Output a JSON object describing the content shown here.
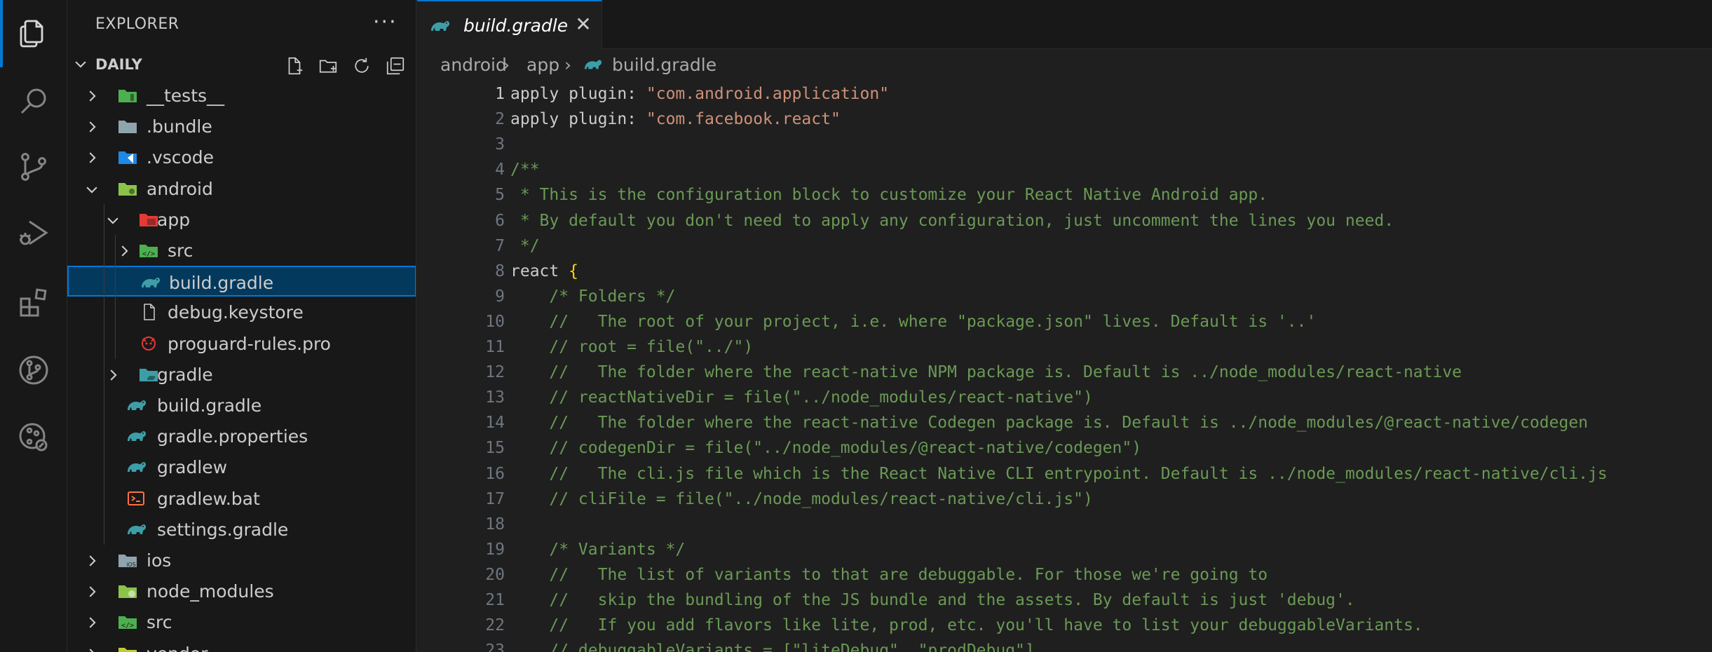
{
  "activity_bar": {
    "items": [
      {
        "name": "explorer-icon",
        "active": true
      },
      {
        "name": "search-icon"
      },
      {
        "name": "source-control-icon"
      },
      {
        "name": "run-debug-icon"
      },
      {
        "name": "extensions-icon"
      },
      {
        "name": "git-graph-icon"
      },
      {
        "name": "remote-explorer-icon"
      }
    ]
  },
  "sidebar": {
    "title": "EXPLORER",
    "more_label": "···",
    "section_label": "DAILY",
    "tree": [
      {
        "label": "__tests__",
        "depth": 0,
        "chevron": "right",
        "icon": "folder-tests",
        "color": "#4caf50"
      },
      {
        "label": ".bundle",
        "depth": 0,
        "chevron": "right",
        "icon": "folder",
        "color": "#90a4ae"
      },
      {
        "label": ".vscode",
        "depth": 0,
        "chevron": "right",
        "icon": "folder-vscode",
        "color": "#1e88e5"
      },
      {
        "label": "android",
        "depth": 0,
        "chevron": "down",
        "icon": "folder-android",
        "color": "#8bc34a"
      },
      {
        "label": "app",
        "depth": 1,
        "chevron": "down",
        "icon": "folder-app",
        "color": "#e53935"
      },
      {
        "label": "src",
        "depth": 2,
        "chevron": "right",
        "icon": "folder-src",
        "color": "#4caf50"
      },
      {
        "label": "build.gradle",
        "depth": 2,
        "chevron": "none",
        "icon": "gradle",
        "color": "#3d9ea8",
        "selected": true
      },
      {
        "label": "debug.keystore",
        "depth": 2,
        "chevron": "none",
        "icon": "file",
        "color": "#cccccc"
      },
      {
        "label": "proguard-rules.pro",
        "depth": 2,
        "chevron": "none",
        "icon": "proguard",
        "color": "#e53935"
      },
      {
        "label": "gradle",
        "depth": 1,
        "chevron": "right",
        "icon": "folder-gradle",
        "color": "#3d9ea8"
      },
      {
        "label": "build.gradle",
        "depth": 1,
        "chevron": "none",
        "icon": "gradle",
        "color": "#3d9ea8"
      },
      {
        "label": "gradle.properties",
        "depth": 1,
        "chevron": "none",
        "icon": "gradle",
        "color": "#3d9ea8"
      },
      {
        "label": "gradlew",
        "depth": 1,
        "chevron": "none",
        "icon": "gradle",
        "color": "#3d9ea8"
      },
      {
        "label": "gradlew.bat",
        "depth": 1,
        "chevron": "none",
        "icon": "terminal",
        "color": "#ff7043"
      },
      {
        "label": "settings.gradle",
        "depth": 1,
        "chevron": "none",
        "icon": "gradle",
        "color": "#3d9ea8"
      },
      {
        "label": "ios",
        "depth": 0,
        "chevron": "right",
        "icon": "folder-ios",
        "color": "#90a4ae"
      },
      {
        "label": "node_modules",
        "depth": 0,
        "chevron": "right",
        "icon": "folder-node",
        "color": "#8bc34a"
      },
      {
        "label": "src",
        "depth": 0,
        "chevron": "right",
        "icon": "folder-src",
        "color": "#4caf50"
      },
      {
        "label": "vendor",
        "depth": 0,
        "chevron": "right",
        "icon": "folder-vendor",
        "color": "#c0ca33"
      }
    ]
  },
  "editor": {
    "tab": {
      "label": "build.gradle",
      "close": "✕"
    },
    "breadcrumb": [
      "android",
      "app",
      "build.gradle"
    ],
    "active_line": 1,
    "lines": [
      {
        "n": "1",
        "tokens": [
          {
            "t": "apply plugin: ",
            "k": "plain"
          },
          {
            "t": "\"com.android.application\"",
            "k": "str"
          }
        ]
      },
      {
        "n": "2",
        "tokens": [
          {
            "t": "apply plugin: ",
            "k": "plain"
          },
          {
            "t": "\"com.facebook.react\"",
            "k": "str"
          }
        ]
      },
      {
        "n": "3",
        "tokens": []
      },
      {
        "n": "4",
        "tokens": [
          {
            "t": "/**",
            "k": "cm"
          }
        ]
      },
      {
        "n": "5",
        "tokens": [
          {
            "t": " * This is the configuration block to customize your React Native Android app.",
            "k": "cm"
          }
        ]
      },
      {
        "n": "6",
        "tokens": [
          {
            "t": " * By default you don't need to apply any configuration, just uncomment the lines you need.",
            "k": "cm"
          }
        ]
      },
      {
        "n": "7",
        "tokens": [
          {
            "t": " */",
            "k": "cm"
          }
        ]
      },
      {
        "n": "8",
        "tokens": [
          {
            "t": "react ",
            "k": "plain"
          },
          {
            "t": "{",
            "k": "br"
          }
        ]
      },
      {
        "n": "9",
        "tokens": [
          {
            "t": "    /* Folders */",
            "k": "cm"
          }
        ]
      },
      {
        "n": "10",
        "tokens": [
          {
            "t": "    //   The root of your project, i.e. where \"package.json\" lives. Default is '..'",
            "k": "cm"
          }
        ]
      },
      {
        "n": "11",
        "tokens": [
          {
            "t": "    // root = file(\"../\")",
            "k": "cm"
          }
        ]
      },
      {
        "n": "12",
        "tokens": [
          {
            "t": "    //   The folder where the react-native NPM package is. Default is ../node_modules/react-native",
            "k": "cm"
          }
        ]
      },
      {
        "n": "13",
        "tokens": [
          {
            "t": "    // reactNativeDir = file(\"../node_modules/react-native\")",
            "k": "cm"
          }
        ]
      },
      {
        "n": "14",
        "tokens": [
          {
            "t": "    //   The folder where the react-native Codegen package is. Default is ../node_modules/@react-native/codegen",
            "k": "cm"
          }
        ]
      },
      {
        "n": "15",
        "tokens": [
          {
            "t": "    // codegenDir = file(\"../node_modules/@react-native/codegen\")",
            "k": "cm"
          }
        ]
      },
      {
        "n": "16",
        "tokens": [
          {
            "t": "    //   The cli.js file which is the React Native CLI entrypoint. Default is ../node_modules/react-native/cli.js",
            "k": "cm"
          }
        ]
      },
      {
        "n": "17",
        "tokens": [
          {
            "t": "    // cliFile = file(\"../node_modules/react-native/cli.js\")",
            "k": "cm"
          }
        ]
      },
      {
        "n": "18",
        "tokens": []
      },
      {
        "n": "19",
        "tokens": [
          {
            "t": "    /* Variants */",
            "k": "cm"
          }
        ]
      },
      {
        "n": "20",
        "tokens": [
          {
            "t": "    //   The list of variants to that are debuggable. For those we're going to",
            "k": "cm"
          }
        ]
      },
      {
        "n": "21",
        "tokens": [
          {
            "t": "    //   skip the bundling of the JS bundle and the assets. By default is just 'debug'.",
            "k": "cm"
          }
        ]
      },
      {
        "n": "22",
        "tokens": [
          {
            "t": "    //   If you add flavors like lite, prod, etc. you'll have to list your debuggableVariants.",
            "k": "cm"
          }
        ]
      },
      {
        "n": "23",
        "tokens": [
          {
            "t": "    // debuggableVariants = [\"liteDebug\", \"prodDebug\"]",
            "k": "cm"
          }
        ]
      }
    ]
  }
}
